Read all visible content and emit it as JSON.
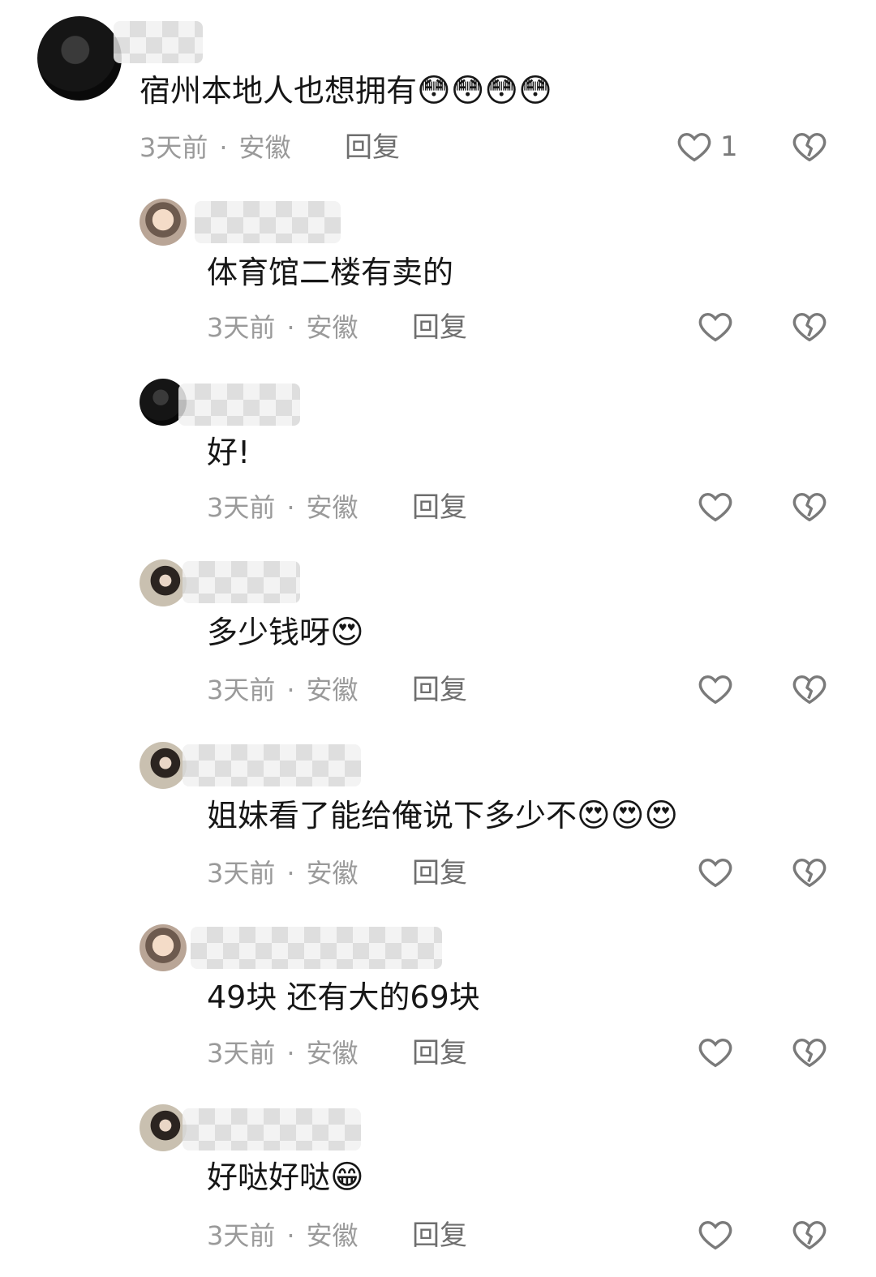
{
  "comments": [
    {
      "text": "宿州本地人也想拥有",
      "emoji": "😳😳😳😳",
      "time": "3天前",
      "location": "安徽",
      "reply": "回复",
      "likes": "1"
    },
    {
      "text": "体育馆二楼有卖的",
      "emoji": "",
      "time": "3天前",
      "location": "安徽",
      "reply": "回复",
      "likes": ""
    },
    {
      "text": "好!",
      "emoji": "",
      "time": "3天前",
      "location": "安徽",
      "reply": "回复",
      "likes": ""
    },
    {
      "text": "多少钱呀",
      "emoji": "😍",
      "time": "3天前",
      "location": "安徽",
      "reply": "回复",
      "likes": ""
    },
    {
      "text": "姐妹看了能给俺说下多少不",
      "emoji": "😍😍😍",
      "time": "3天前",
      "location": "安徽",
      "reply": "回复",
      "likes": ""
    },
    {
      "text": "49块 还有大的69块",
      "emoji": "",
      "time": "3天前",
      "location": "安徽",
      "reply": "回复",
      "likes": ""
    },
    {
      "text": "好哒好哒",
      "emoji": "😁",
      "time": "3天前",
      "location": "安徽",
      "reply": "回复",
      "likes": ""
    }
  ],
  "separator": "·",
  "colors": {
    "text": "#161616",
    "meta": "#9a9a9a",
    "icon": "#7a7a7a"
  },
  "icons": {
    "like": "heart-outline-icon",
    "dislike": "broken-heart-icon"
  }
}
